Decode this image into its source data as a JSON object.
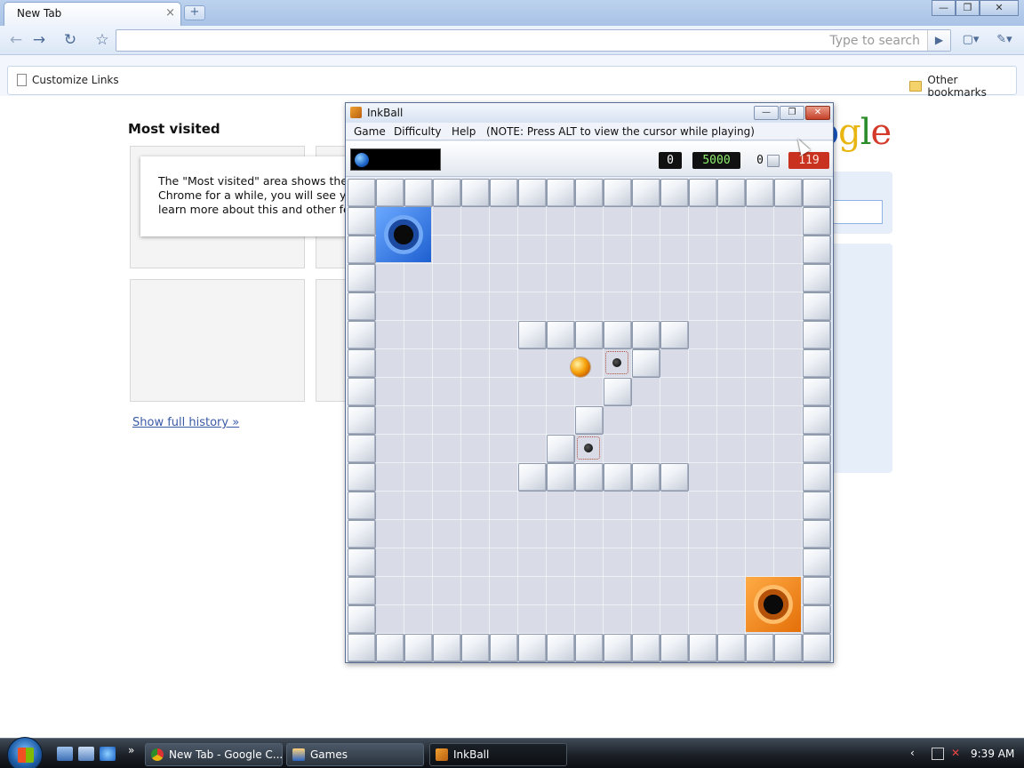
{
  "chrome": {
    "tab_title": "New Tab",
    "tab_close": "×",
    "new_tab": "+",
    "win_min": "—",
    "win_max": "❐",
    "win_close": "✕",
    "omnibox_placeholder": "Type to search",
    "go": "▶",
    "back": "←",
    "forward": "→",
    "reload": "↻",
    "star": "☆",
    "page_menu": "▢▾",
    "wrench_menu": "✎▾",
    "bookmark_customize": "Customize Links",
    "bookmark_other": "Other bookmarks"
  },
  "ntp": {
    "most_visited": "Most visited",
    "info_line1": "The \"Most visited\" area shows the w",
    "info_line2": "Chrome for a while, you will see you",
    "info_line3": "learn more about this and other featu",
    "show_history": "Show full history »",
    "google": "ogle"
  },
  "inkball": {
    "title": "InkBall",
    "menu": [
      "Game",
      "Difficulty",
      "Help",
      "(NOTE: Press ALT to view the cursor while playing)"
    ],
    "score": "0",
    "bonus": "5000",
    "blocks_count": "0",
    "timer": "119",
    "hole_colors": {
      "blue": "#1d5fd0",
      "orange": "#e46f08"
    },
    "ball_color": "#f7a30c"
  },
  "taskbar": {
    "tasks": [
      "New Tab - Google C...",
      "Games",
      "InkBall"
    ],
    "clock": "9:39 AM",
    "overflow": "»"
  }
}
